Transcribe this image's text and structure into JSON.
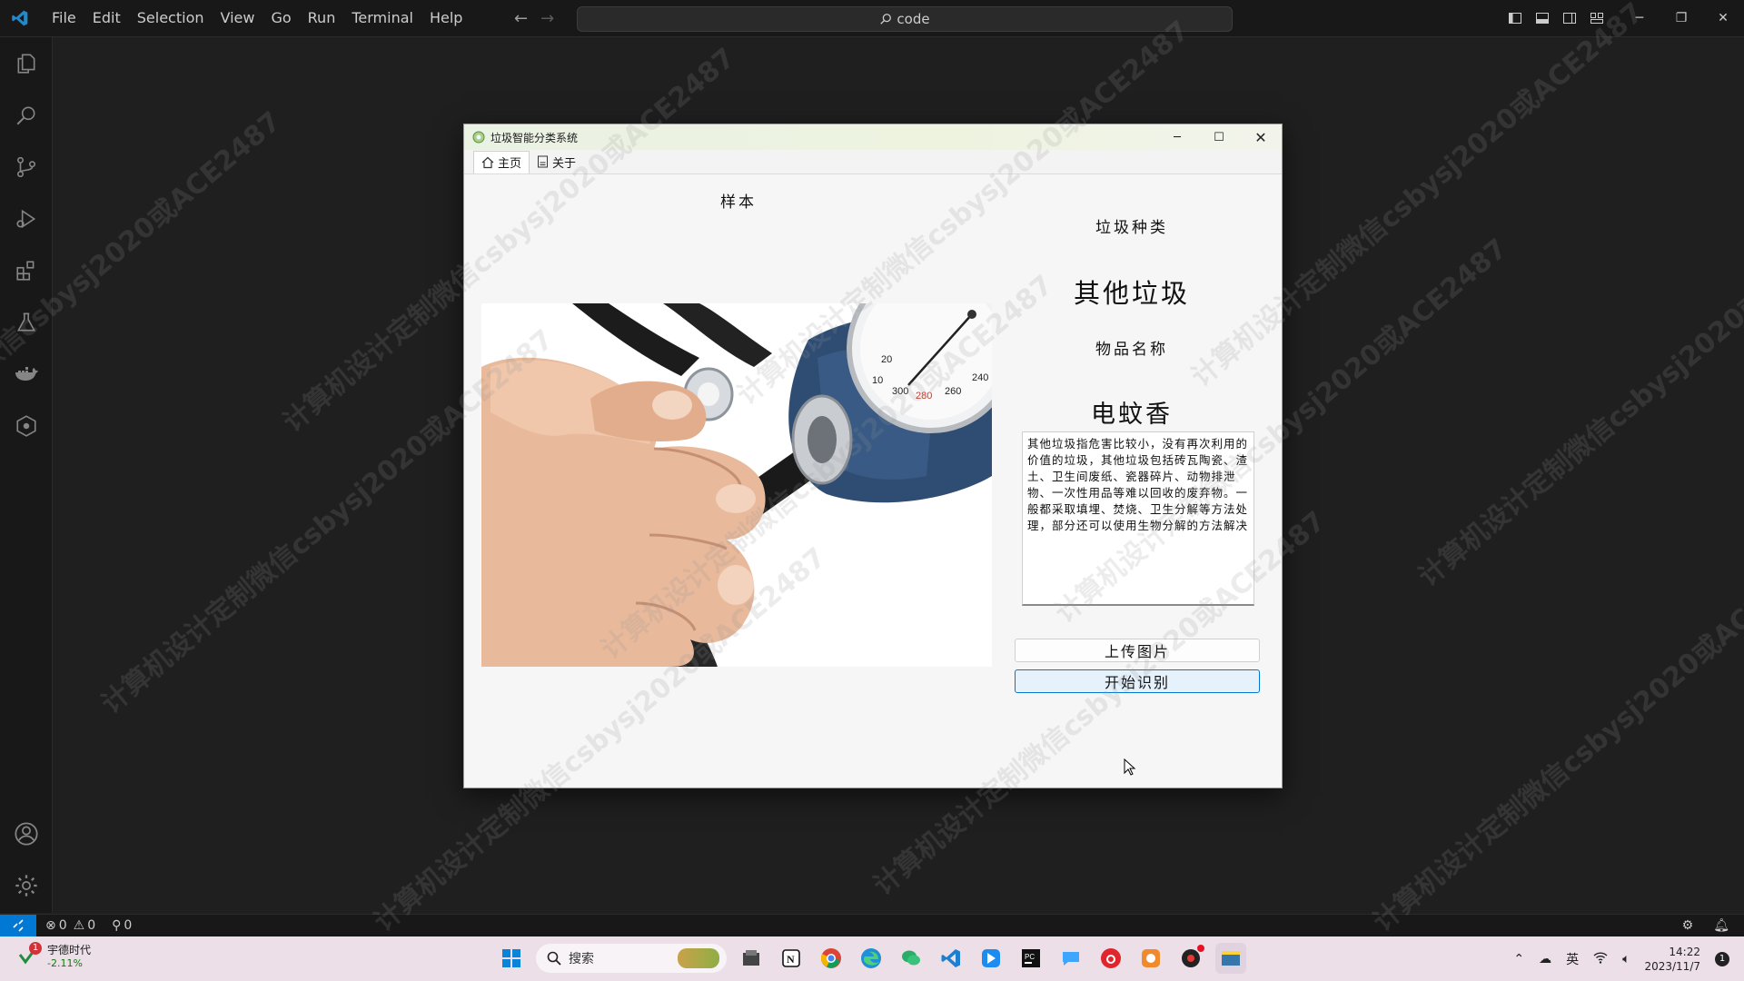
{
  "vscode": {
    "menu": [
      "File",
      "Edit",
      "Selection",
      "View",
      "Go",
      "Run",
      "Terminal",
      "Help"
    ],
    "search_text": "code",
    "status": {
      "errors": "0",
      "warnings": "0",
      "ports": "0"
    }
  },
  "app": {
    "title": "垃圾智能分类系统",
    "tabs": [
      {
        "label": "主页",
        "icon": "home-icon",
        "active": true
      },
      {
        "label": "关于",
        "icon": "document-icon",
        "active": false
      }
    ],
    "sample_label": "样本",
    "category_label": "垃圾种类",
    "category_value": "其他垃圾",
    "item_label": "物品名称",
    "item_value": "电蚊香",
    "description": "其他垃圾指危害比较小，没有再次利用的价值的垃圾，其他垃圾包括砖瓦陶瓷、渣土、卫生间废纸、瓷器碎片、动物排泄物、一次性用品等难以回收的废弃物。一般都采取填埋、焚烧、卫生分解等方法处理，部分还可以使用生物分解的方法解决",
    "upload_button": "上传图片",
    "recognize_button": "开始识别"
  },
  "taskbar": {
    "stock_name": "宇德时代",
    "stock_change": "-2.11%",
    "stock_badge": "1",
    "search_placeholder": "搜索",
    "ime": "英",
    "time": "14:22",
    "date": "2023/11/7",
    "notification_count": "1"
  },
  "watermark_text": "计算机设计定制微信csbysj2020或ACE2487"
}
